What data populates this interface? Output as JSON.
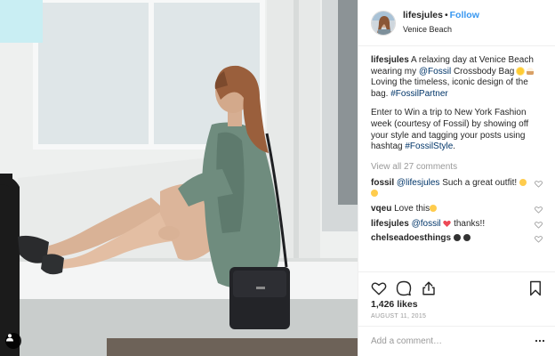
{
  "header": {
    "username": "lifesjules",
    "dot": "•",
    "follow_label": "Follow",
    "location": "Venice Beach"
  },
  "caption": {
    "username": "lifesjules",
    "text_1": " A relaxing day at Venice Beach wearing my ",
    "mention": "@Fossil",
    "text_2": " Crossbody Bag ",
    "text_3": " Loving the timeless, iconic design of the bag. ",
    "hashtag_1": "#FossilPartner",
    "para2_text": "Enter to Win a trip to New York Fashion week (courtesy of Fossil) by showing off your style and tagging your posts using hashtag ",
    "hashtag_2": "#FossilStyle",
    "para2_end": "."
  },
  "view_all": "View all 27 comments",
  "comments": [
    {
      "username": "fossil",
      "mention": "@lifesjules",
      "text": " Such a great outfit!"
    },
    {
      "username": "vqeu",
      "text": " Love this"
    },
    {
      "username": "lifesjules",
      "mention": "@fossil",
      "text": " thanks!!"
    },
    {
      "username": "chelseadoesthings",
      "text": " "
    }
  ],
  "likes": "1,426 likes",
  "date": "AUGUST 11, 2015",
  "add_comment_placeholder": "Add a comment…",
  "icons": {
    "like": "heart-icon",
    "comment": "comment-icon",
    "share": "share-icon",
    "save": "bookmark-icon",
    "more": "more-options-icon",
    "user_tag": "user-tag-icon"
  },
  "colors": {
    "accent": "#3897f0",
    "link": "#003569",
    "muted": "#999999",
    "heart_red": "#ed4956"
  }
}
